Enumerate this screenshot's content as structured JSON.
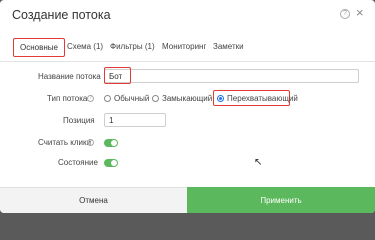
{
  "dialog": {
    "title": "Создание потока",
    "help_icon": "?",
    "close_icon": "×"
  },
  "tabs": [
    {
      "label": "Основные",
      "active": true
    },
    {
      "label": "Схема (1)",
      "active": false
    },
    {
      "label": "Фильтры (1)",
      "active": false
    },
    {
      "label": "Мониторинг",
      "active": false
    },
    {
      "label": "Заметки",
      "active": false
    }
  ],
  "form": {
    "name_label": "Название потока",
    "name_value": "Бот",
    "type_label": "Тип потока",
    "type_help": "?",
    "type_options": [
      {
        "label": "Обычный",
        "selected": false
      },
      {
        "label": "Замыкающий",
        "selected": false
      },
      {
        "label": "Перехватывающий",
        "selected": true
      }
    ],
    "position_label": "Позиция",
    "position_value": "1",
    "count_clicks_label": "Считать клики",
    "count_clicks_help": "?",
    "count_clicks_on": true,
    "state_label": "Состояние",
    "state_on": true
  },
  "footer": {
    "cancel_label": "Отмена",
    "apply_label": "Применить"
  },
  "colors": {
    "accent_green": "#5cb85c",
    "highlight_red": "#e53935",
    "radio_blue": "#1e73e8"
  }
}
